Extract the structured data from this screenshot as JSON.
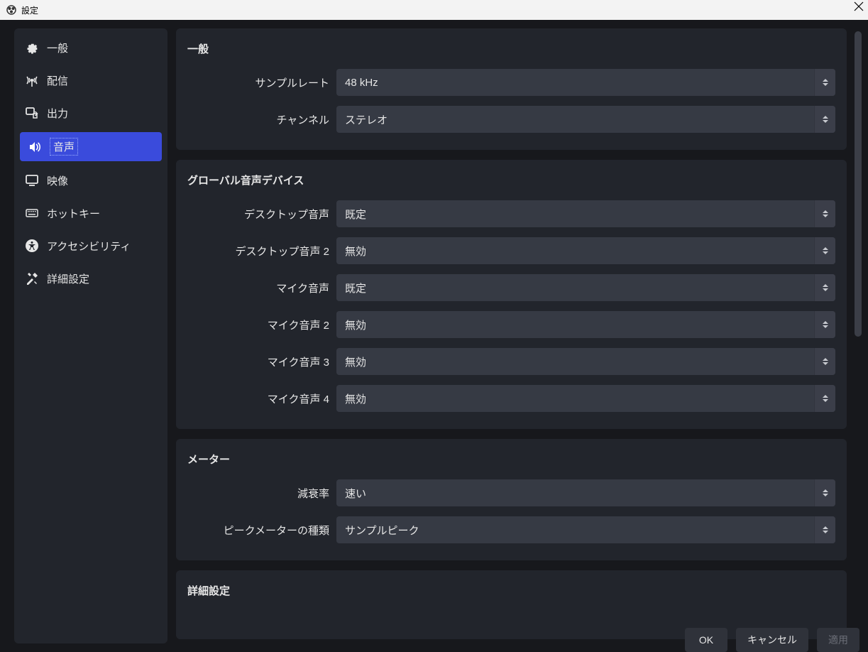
{
  "window": {
    "title": "設定"
  },
  "sidebar": {
    "items": [
      {
        "label": "一般"
      },
      {
        "label": "配信"
      },
      {
        "label": "出力"
      },
      {
        "label": "音声"
      },
      {
        "label": "映像"
      },
      {
        "label": "ホットキー"
      },
      {
        "label": "アクセシビリティ"
      },
      {
        "label": "詳細設定"
      }
    ]
  },
  "sections": {
    "general": {
      "title": "一般",
      "sample_rate_label": "サンプルレート",
      "sample_rate_value": "48 kHz",
      "channel_label": "チャンネル",
      "channel_value": "ステレオ"
    },
    "global_devices": {
      "title": "グローバル音声デバイス",
      "desktop1_label": "デスクトップ音声",
      "desktop1_value": "既定",
      "desktop2_label": "デスクトップ音声 2",
      "desktop2_value": "無効",
      "mic1_label": "マイク音声",
      "mic1_value": "既定",
      "mic2_label": "マイク音声 2",
      "mic2_value": "無効",
      "mic3_label": "マイク音声 3",
      "mic3_value": "無効",
      "mic4_label": "マイク音声 4",
      "mic4_value": "無効"
    },
    "meter": {
      "title": "メーター",
      "decay_label": "減衰率",
      "decay_value": "速い",
      "peak_label": "ピークメーターの種類",
      "peak_value": "サンプルピーク"
    },
    "advanced": {
      "title": "詳細設定"
    }
  },
  "footer": {
    "ok": "OK",
    "cancel": "キャンセル",
    "apply": "適用"
  }
}
